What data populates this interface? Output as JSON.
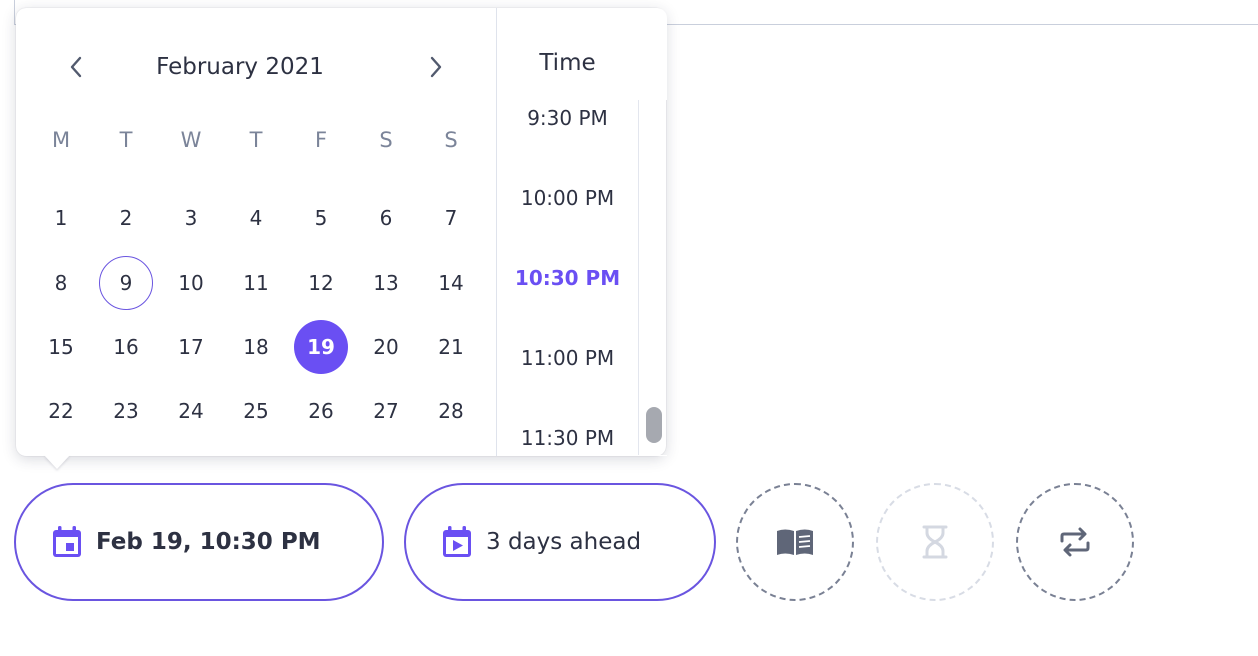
{
  "calendar": {
    "month_label": "February 2021",
    "weekdays": [
      "M",
      "T",
      "W",
      "T",
      "F",
      "S",
      "S"
    ],
    "weeks": [
      [
        "1",
        "2",
        "3",
        "4",
        "5",
        "6",
        "7"
      ],
      [
        "8",
        "9",
        "10",
        "11",
        "12",
        "13",
        "14"
      ],
      [
        "15",
        "16",
        "17",
        "18",
        "19",
        "20",
        "21"
      ],
      [
        "22",
        "23",
        "24",
        "25",
        "26",
        "27",
        "28"
      ]
    ],
    "today": "9",
    "selected": "19"
  },
  "time": {
    "title": "Time",
    "options": [
      "9:30 PM",
      "10:00 PM",
      "10:30 PM",
      "11:00 PM",
      "11:30 PM"
    ],
    "selected": "10:30 PM"
  },
  "actions": {
    "date_pill": "Feb 19, 10:30 PM",
    "relative_pill": "3 days ahead"
  },
  "colors": {
    "accent": "#6a4ff3",
    "text": "#2d3142",
    "muted": "#7b8499"
  }
}
